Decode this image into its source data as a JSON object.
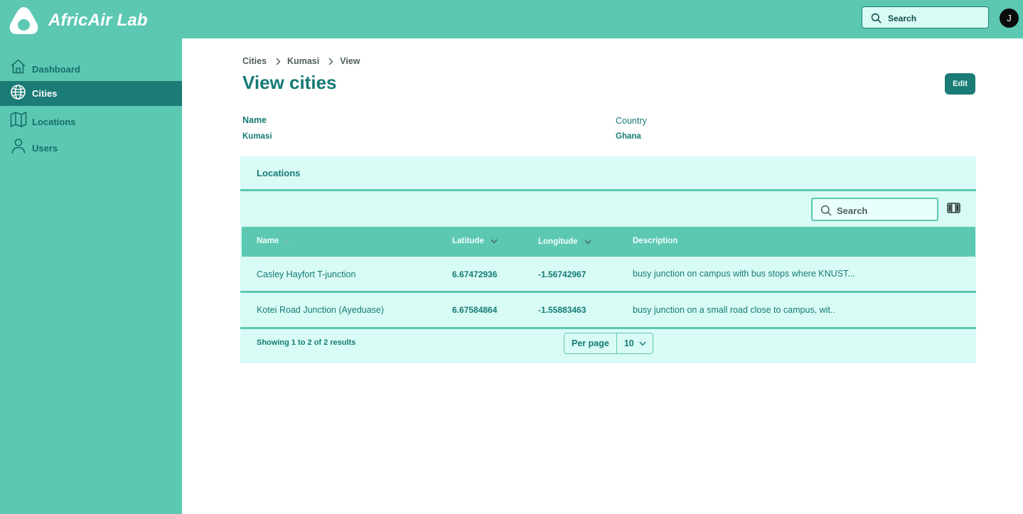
{
  "app": {
    "brand": "AfricAir Lab"
  },
  "header": {
    "search_placeholder": "Search",
    "avatar_initial": "J"
  },
  "sidebar": {
    "items": [
      {
        "label": "Dashboard",
        "icon": "home-icon",
        "active": false
      },
      {
        "label": "Cities",
        "icon": "globe-icon",
        "active": true
      },
      {
        "label": "Locations",
        "icon": "map-icon",
        "active": false
      },
      {
        "label": "Users",
        "icon": "user-icon",
        "active": false
      }
    ]
  },
  "breadcrumb": [
    "Cities",
    "Kumasi",
    "View"
  ],
  "page": {
    "title": "View cities",
    "edit_label": "Edit",
    "fields": [
      {
        "label": "Name",
        "value": "Kumasi"
      },
      {
        "label": "Country",
        "value": "Ghana"
      }
    ]
  },
  "locations": {
    "title": "Locations",
    "search_placeholder": "Search",
    "columns": [
      "Name",
      "Latitude",
      "Longitude",
      "Description"
    ],
    "rows": [
      {
        "name": "Casley Hayfort T-junction",
        "latitude": "6.67472936",
        "longitude": "-1.56742967",
        "description": "busy junction on campus with bus stops where KNUST..."
      },
      {
        "name": "Kotei Road Junction (Ayeduase)",
        "latitude": "6.67584864",
        "longitude": "-1.55883463",
        "description": "busy junction on a small road close to campus, wit.."
      }
    ],
    "footer": {
      "summary": "Showing 1 to 2 of 2 results",
      "per_page_label": "Per page",
      "per_page_value": "10"
    }
  },
  "colors": {
    "primary": "#5cc8b2",
    "primary_dark": "#1b7b76",
    "panel_bg": "#d9fbf6",
    "text": "#157a74"
  }
}
